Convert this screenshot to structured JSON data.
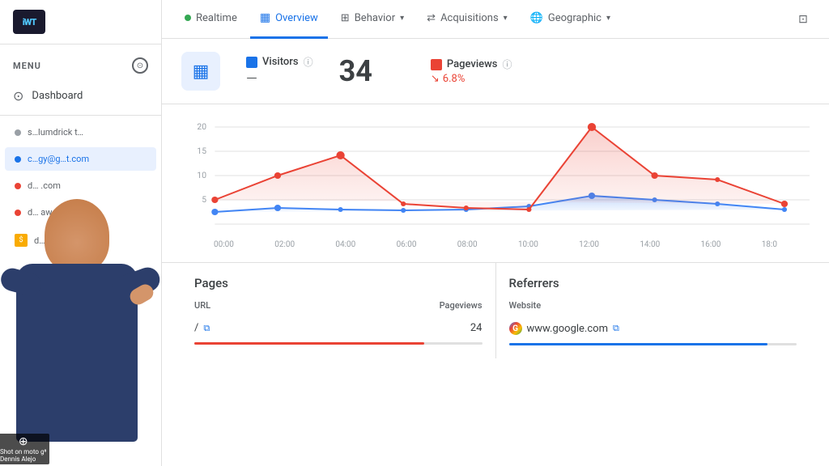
{
  "sidebar": {
    "logo_text": "iWT",
    "menu_label": "MENU",
    "items": [
      {
        "label": "Dashboard",
        "icon": "⊙"
      }
    ],
    "sites": [
      {
        "label": "s...lumdrick t...",
        "active": false,
        "color": "grey"
      },
      {
        "label": "c...gy@g...t.com",
        "active": true,
        "color": "blue"
      },
      {
        "label": "d...          .com",
        "active": false,
        "color": "red"
      },
      {
        "label": "d...      away...",
        "active": false,
        "color": "red"
      },
      {
        "label": "d...              ...",
        "active": false,
        "color": "orange"
      }
    ]
  },
  "nav": {
    "tabs": [
      {
        "label": "Realtime",
        "icon": "dot",
        "active": false
      },
      {
        "label": "Overview",
        "icon": "chart",
        "active": true
      },
      {
        "label": "Behavior",
        "icon": "grid",
        "active": false,
        "has_chevron": true
      },
      {
        "label": "Acquisitions",
        "icon": "arrows",
        "active": false,
        "has_chevron": true
      },
      {
        "label": "Geographic",
        "icon": "globe",
        "active": false,
        "has_chevron": true
      }
    ]
  },
  "stats": {
    "visitors_label": "Visitors",
    "visitors_value": "34",
    "pageviews_label": "Pageviews",
    "pageviews_change": "6.8%",
    "pageviews_change_direction": "down"
  },
  "chart": {
    "y_labels": [
      "20",
      "15",
      "10",
      "5",
      ""
    ],
    "x_labels": [
      "00:00",
      "02:00",
      "04:00",
      "06:00",
      "08:00",
      "10:00",
      "12:00",
      "14:00",
      "16:00",
      "18:0"
    ]
  },
  "pages_panel": {
    "title": "Pages",
    "col_url": "URL",
    "col_pageviews": "Pageviews",
    "rows": [
      {
        "url": "/",
        "pageviews": "24",
        "progress": 80
      }
    ]
  },
  "referrers_panel": {
    "title": "Referrers",
    "col_website": "Website",
    "rows": [
      {
        "site": "www.google.com",
        "has_external": true
      }
    ]
  },
  "moto_badge": "Shot on moto g⁸\nDennis Alejo"
}
